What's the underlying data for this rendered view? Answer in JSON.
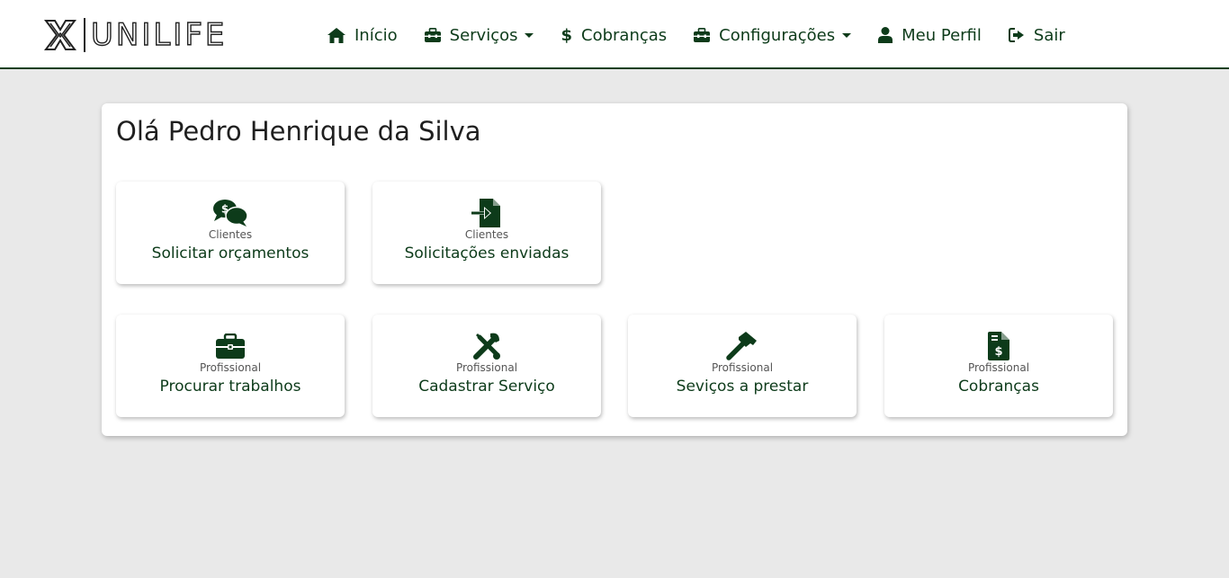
{
  "brand": {
    "name": "UNILIFE",
    "logo_icon": "unilife-x-logo"
  },
  "nav": {
    "items": [
      {
        "label": "Início",
        "icon": "home-icon"
      },
      {
        "label": "Serviços",
        "icon": "toolbox-icon",
        "dropdown": true
      },
      {
        "label": "Cobranças",
        "icon": "dollar-icon"
      },
      {
        "label": "Configurações",
        "icon": "toolbox-icon",
        "dropdown": true
      },
      {
        "label": "Meu Perfil",
        "icon": "user-icon"
      },
      {
        "label": "Sair",
        "icon": "sign-out-icon"
      }
    ]
  },
  "greeting": "Olá Pedro Henrique da Silva",
  "tiles": [
    {
      "category": "Clientes",
      "label": "Solicitar orçamentos",
      "icon": "comments-dollar-icon"
    },
    {
      "category": "Clientes",
      "label": "Solicitações enviadas",
      "icon": "file-import-icon"
    },
    {
      "category": "Profissional",
      "label": "Procurar trabalhos",
      "icon": "briefcase-icon"
    },
    {
      "category": "Profissional",
      "label": "Cadastrar Serviço",
      "icon": "tools-icon"
    },
    {
      "category": "Profissional",
      "label": "Seviços a prestar",
      "icon": "hammer-icon"
    },
    {
      "category": "Profissional",
      "label": "Cobranças",
      "icon": "file-invoice-dollar-icon"
    }
  ],
  "colors": {
    "accent": "#0d3b1a",
    "background": "#e9e9e9",
    "navbar_border": "#0e3f1c"
  }
}
